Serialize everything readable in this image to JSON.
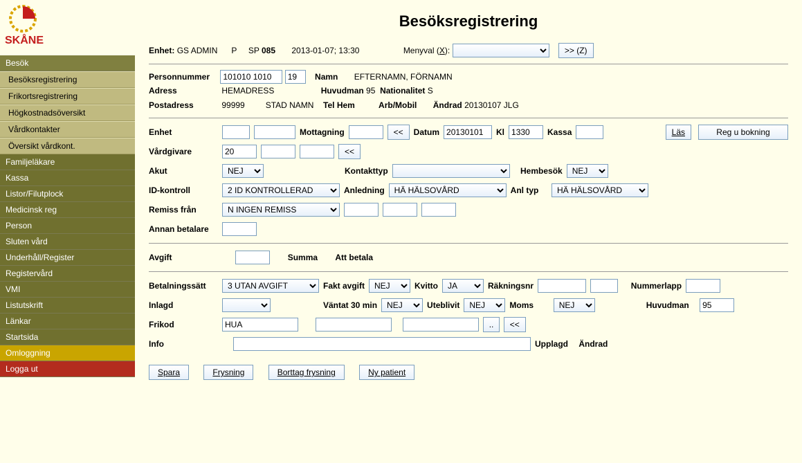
{
  "header": {
    "title": "Besöksregistrering",
    "enhet_label": "Enhet:",
    "enhet_value": "GS ADMIN",
    "p": "P",
    "sp": "SP",
    "sp_val": "085",
    "ts": "2013-01-07; 13:30",
    "menyval_label": "Menyval (X):",
    "go_btn": ">> (Z)"
  },
  "nav": {
    "top": "Besök",
    "sub": [
      "Besöksregistrering",
      "Frikortsregistrering",
      "Högkostnadsöversikt",
      "Vårdkontakter",
      "Översikt vårdkont."
    ],
    "main": [
      "Familjeläkare",
      "Kassa",
      "Listor/Filutplock",
      "Medicinsk reg",
      "Person",
      "Sluten vård",
      "Underhåll/Register",
      "Registervård",
      "VMI",
      "Listutskrift",
      "Länkar",
      "Startsida"
    ],
    "login": "Omloggning",
    "logout": "Logga ut"
  },
  "patient": {
    "pn_label": "Personnummer",
    "pn1": "101010 1010",
    "pn2": "19",
    "namn_label": "Namn",
    "namn": "EFTERNAMN, FÖRNAMN",
    "adress_label": "Adress",
    "adress": "HEMADRESS",
    "huvudman_label": "Huvudman",
    "huvudman": "95",
    "nationalitet_label": "Nationalitet",
    "nationalitet": "S",
    "postadress_label": "Postadress",
    "postnr": "99999",
    "postort": "STAD NAMN",
    "telhem_label": "Tel Hem",
    "arbmobil_label": "Arb/Mobil",
    "andrad_label": "Ändrad",
    "andrad": "20130107 JLG"
  },
  "form": {
    "enhet": "Enhet",
    "mottagning": "Mottagning",
    "prev": "<<",
    "datum_label": "Datum",
    "datum": "20130101",
    "kl_label": "Kl",
    "kl": "1330",
    "kassa": "Kassa",
    "las": "Läs",
    "reg": "Reg u bokning",
    "vardgivare": "Vårdgivare",
    "vardgivare_v": "20",
    "vardgivare_prev": "<<",
    "akut": "Akut",
    "akut_v": "NEJ",
    "kontakttyp": "Kontakttyp",
    "hembesok": "Hembesök",
    "hembesok_v": "NEJ",
    "idkontroll": "ID-kontroll",
    "idkontroll_v": "2 ID KONTROLLERAD",
    "anledning": "Anledning",
    "anledning_v": "HÄ HÄLSOVÅRD",
    "anltyp": "Anl typ",
    "anltyp_v": "HÄ HÄLSOVÅRD",
    "remiss": "Remiss från",
    "remiss_v": "N INGEN REMISS",
    "annan": "Annan betalare",
    "avgift": "Avgift",
    "summa": "Summa",
    "attbetala": "Att betala",
    "betsatt": "Betalningssätt",
    "betsatt_v": "3 UTAN AVGIFT",
    "faktavg": "Fakt avgift",
    "faktavg_v": "NEJ",
    "kvitto": "Kvitto",
    "kvitto_v": "JA",
    "rakningsnr": "Räkningsnr",
    "nummerlapp": "Nummerlapp",
    "inlagd": "Inlagd",
    "vantat": "Väntat 30 min",
    "vantat_v": "NEJ",
    "uteblivit": "Uteblivit",
    "uteblivit_v": "NEJ",
    "moms": "Moms",
    "moms_v": "NEJ",
    "huvudman2": "Huvudman",
    "huvudman2_v": "95",
    "frikod": "Frikod",
    "frikod_v": "HUA",
    "frikod_btn": "..",
    "frikod_prev": "<<",
    "info": "Info",
    "upplagd": "Upplagd",
    "andrad": "Ändrad"
  },
  "buttons": {
    "spara": "Spara",
    "frysning": "Frysning",
    "borttag": "Borttag frysning",
    "ny": "Ny patient"
  }
}
